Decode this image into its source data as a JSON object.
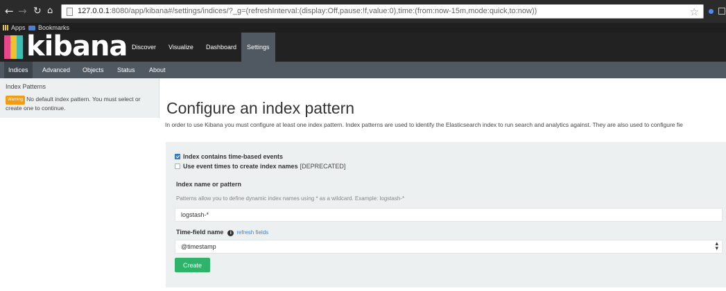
{
  "browser": {
    "back_icon": "arrow-left",
    "forward_icon": "arrow-right",
    "reload_icon": "reload",
    "home_icon": "home",
    "url_host": "127.0.0.1",
    "url_rest": ":8080/app/kibana#/settings/indices/?_g=(refreshInterval:(display:Off,pause:!f,value:0),time:(from:now-15m,mode:quick,to:now))",
    "bookmarks": {
      "apps_label": "Apps",
      "bookmarks_label": "Bookmarks"
    }
  },
  "header": {
    "logo_text": "kibana",
    "logo_colors": [
      "#e8488b",
      "#f0c02f",
      "#3ebeb0"
    ],
    "tabs": [
      {
        "label": "Discover"
      },
      {
        "label": "Visualize"
      },
      {
        "label": "Dashboard"
      },
      {
        "label": "Settings",
        "active": true
      }
    ]
  },
  "subnav": {
    "tabs": [
      {
        "label": "Indices",
        "active": true
      },
      {
        "label": "Advanced"
      },
      {
        "label": "Objects"
      },
      {
        "label": "Status"
      },
      {
        "label": "About"
      }
    ]
  },
  "sidebar": {
    "title": "Index Patterns",
    "warning_badge": "Warning",
    "warning_text": "No default index pattern. You must select or create one to continue."
  },
  "main": {
    "title": "Configure an index pattern",
    "description": "In order to use Kibana you must configure at least one index pattern. Index patterns are used to identify the Elasticsearch index to run search and analytics against. They are also used to configure fie",
    "form": {
      "time_based_label": "Index contains time-based events",
      "time_based_checked": true,
      "event_times_label": "Use event times to create index names",
      "event_times_deprecated": "[DEPRECATED]",
      "event_times_checked": false,
      "index_name_label": "Index name or pattern",
      "index_name_hint": "Patterns allow you to define dynamic index names using * as a wildcard. Example: logstash-*",
      "index_name_value": "logstash-*",
      "time_field_label": "Time-field name",
      "refresh_fields_label": "refresh fields",
      "time_field_value": "@timestamp",
      "create_label": "Create"
    }
  },
  "colors": {
    "create_button": "#2fb36b",
    "checkbox_checked": "#3b83d6",
    "warning_badge": "#f39c12",
    "header_bg": "#222222",
    "subnav_bg": "#505862",
    "panel_bg": "#ecf0f1"
  }
}
